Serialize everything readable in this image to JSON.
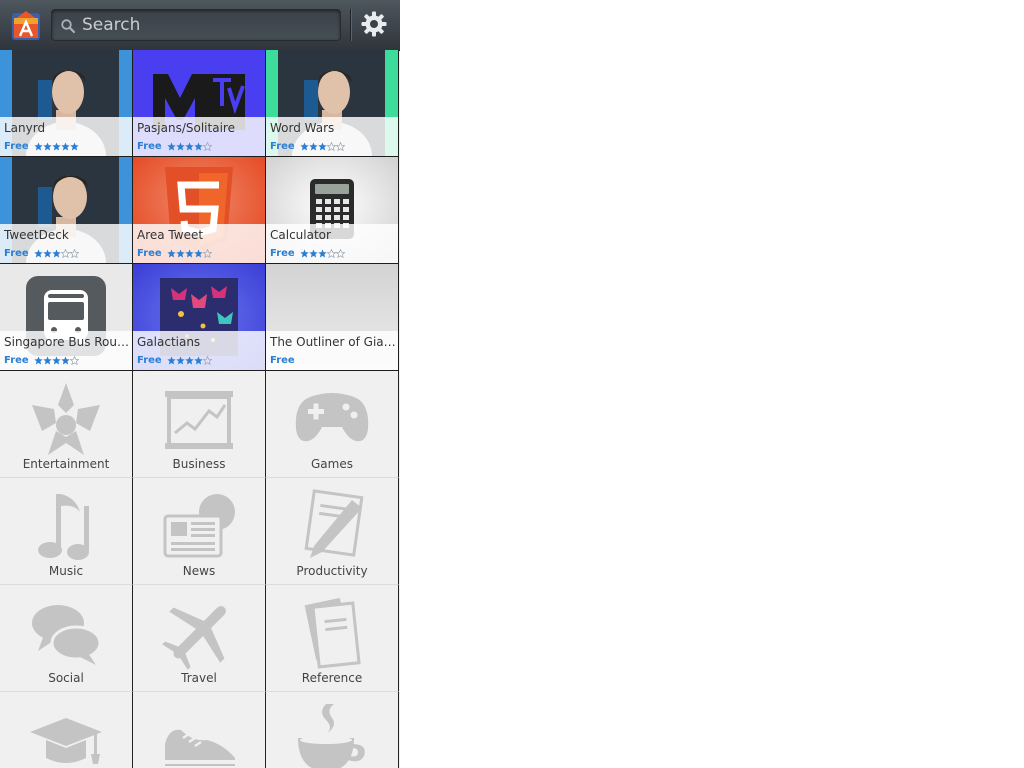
{
  "search": {
    "placeholder": "Search"
  },
  "featured": [
    {
      "name": "Lanyrd",
      "price": "Free",
      "rating": 5,
      "icon": "presenter-photo"
    },
    {
      "name": "Pasjans/Solitaire",
      "price": "Free",
      "rating": 4,
      "icon": "mtv-logo"
    },
    {
      "name": "Word Wars",
      "price": "Free",
      "rating": 3,
      "icon": "presenter-photo"
    },
    {
      "name": "TweetDeck",
      "price": "Free",
      "rating": 3,
      "icon": "presenter-photo"
    },
    {
      "name": "Area Tweet",
      "price": "Free",
      "rating": 4,
      "icon": "html5-logo"
    },
    {
      "name": "Calculator",
      "price": "Free",
      "rating": 3,
      "icon": "calculator"
    },
    {
      "name": "Singapore Bus Route...",
      "price": "Free",
      "rating": 4,
      "icon": "bus"
    },
    {
      "name": "Galactians",
      "price": "Free",
      "rating": 4,
      "icon": "space-invaders"
    },
    {
      "name": "The Outliner of Giants",
      "price": "Free",
      "rating": null,
      "icon": "blank"
    }
  ],
  "categories": [
    {
      "label": "Entertainment",
      "icon": "star-emblem-icon"
    },
    {
      "label": "Business",
      "icon": "chart-board-icon"
    },
    {
      "label": "Games",
      "icon": "gamepad-icon"
    },
    {
      "label": "Music",
      "icon": "music-note-icon"
    },
    {
      "label": "News",
      "icon": "newspaper-icon"
    },
    {
      "label": "Productivity",
      "icon": "pen-paper-icon"
    },
    {
      "label": "Social",
      "icon": "chat-bubbles-icon"
    },
    {
      "label": "Travel",
      "icon": "airplane-icon"
    },
    {
      "label": "Reference",
      "icon": "books-icon"
    },
    {
      "label": "",
      "icon": "graduation-cap-icon"
    },
    {
      "label": "",
      "icon": "sneaker-icon"
    },
    {
      "label": "",
      "icon": "coffee-cup-icon"
    }
  ],
  "colors": {
    "price": "#2a7fd4",
    "topbar": "#3b4249",
    "category_icon": "#c4c4c4"
  }
}
